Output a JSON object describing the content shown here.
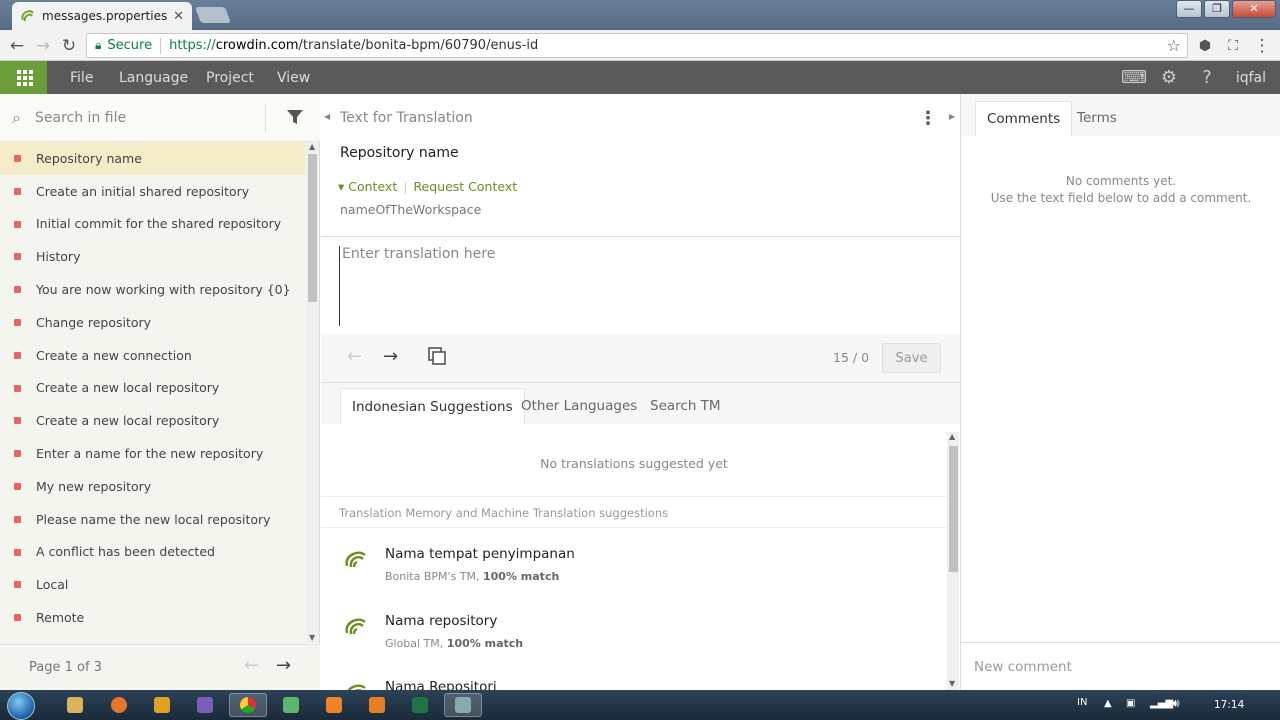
{
  "browser": {
    "tab_title": "messages.properties - Bo",
    "tab_close": "✕",
    "window_buttons": [
      "—",
      "❐",
      "✕"
    ],
    "secure_label": "Secure",
    "url_prefix": "https://",
    "url_domain": "crowdin.com",
    "url_path": "/translate/bonita-bpm/60790/enus-id"
  },
  "menubar": {
    "items": [
      "File",
      "Language",
      "Project",
      "View"
    ],
    "user": "iqfal",
    "icons": [
      "keyboard-icon",
      "gear-icon",
      "help-icon"
    ]
  },
  "sidebar": {
    "search_placeholder": "Search in file",
    "strings": [
      "Repository name",
      "Create an initial shared repository",
      "Initial commit for the shared repository",
      "History",
      "You are now working with repository {0}",
      "Change repository",
      "Create a new connection",
      "Create a new local repository",
      "Create a new local repository",
      "Enter a name for the new repository",
      "My new repository",
      "Please name the new local repository",
      "A conflict has been detected",
      "Local",
      "Remote"
    ],
    "active_index": 0,
    "status_color": "#e66666",
    "page_label": "Page 1 of 3"
  },
  "editor": {
    "header": "Text for Translation",
    "source_text": "Repository name",
    "context_link": "Context",
    "request_context_link": "Request Context",
    "context_value": "nameOfTheWorkspace",
    "translation_placeholder": "Enter translation here",
    "counter": "15 / 0",
    "save_label": "Save",
    "tabs": [
      "Indonesian Suggestions",
      "Other Languages",
      "Search TM"
    ],
    "active_tab": 0,
    "no_suggestions": "No translations suggested yet",
    "tm_header": "Translation Memory and Machine Translation suggestions",
    "tm_items": [
      {
        "text": "Nama tempat penyimpanan",
        "source": "Bonita BPM's TM,",
        "match": "100% match"
      },
      {
        "text": "Nama repository",
        "source": "Global TM,",
        "match": "100% match"
      },
      {
        "text": "Nama Repositori",
        "source": "",
        "match": ""
      }
    ],
    "accent_color": "#6b8e23"
  },
  "comments": {
    "tabs": [
      "Comments",
      "Terms"
    ],
    "empty_line1": "No comments yet.",
    "empty_line2": "Use the text field below to add a comment.",
    "new_comment_placeholder": "New comment"
  },
  "taskbar": {
    "language": "IN",
    "time": "17:14"
  }
}
